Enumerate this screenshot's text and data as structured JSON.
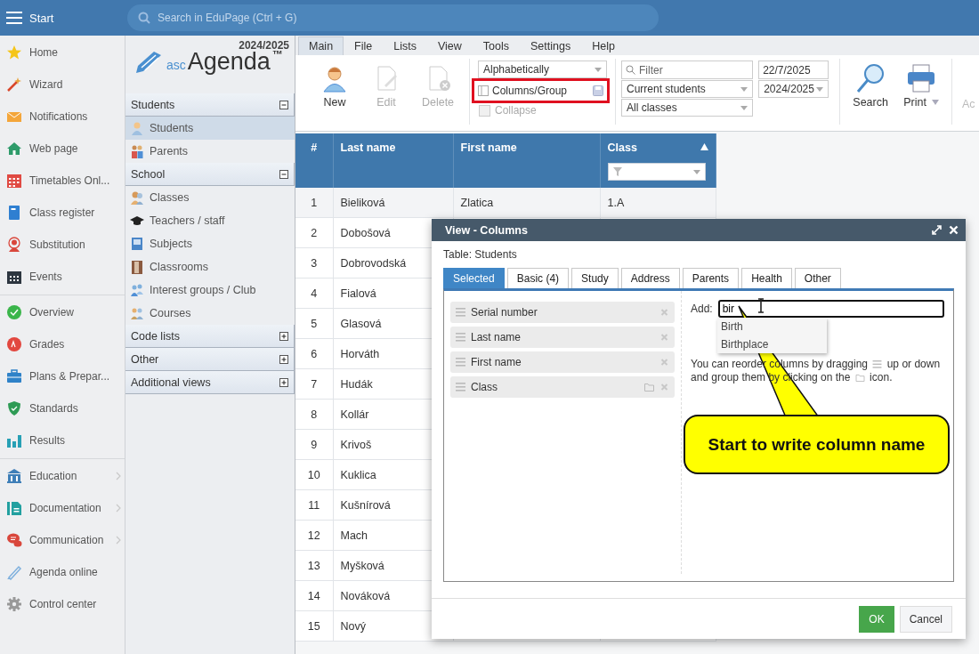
{
  "topbar": {
    "title": "Start",
    "search": {
      "placeholder": "Search in EduPage (Ctrl + G)"
    }
  },
  "sidebar": {
    "sections": [
      {
        "items": [
          {
            "label": "Home",
            "has_submenu": false
          },
          {
            "label": "Wizard",
            "has_submenu": false
          },
          {
            "label": "Notifications",
            "has_submenu": false
          },
          {
            "label": "Web page",
            "has_submenu": false
          },
          {
            "label": "Timetables Onl...",
            "has_submenu": false
          },
          {
            "label": "Class register",
            "has_submenu": false
          },
          {
            "label": "Substitution",
            "has_submenu": false
          },
          {
            "label": "Events",
            "has_submenu": false
          }
        ]
      },
      {
        "items": [
          {
            "label": "Overview",
            "has_submenu": false
          },
          {
            "label": "Grades",
            "has_submenu": false
          },
          {
            "label": "Plans & Prepar...",
            "has_submenu": false
          },
          {
            "label": "Standards",
            "has_submenu": false
          },
          {
            "label": "Results",
            "has_submenu": false
          }
        ]
      },
      {
        "items": [
          {
            "label": "Education",
            "has_submenu": true
          },
          {
            "label": "Documentation",
            "has_submenu": true
          },
          {
            "label": "Communication",
            "has_submenu": true
          },
          {
            "label": "Agenda online",
            "has_submenu": false
          },
          {
            "label": "Control center",
            "has_submenu": false
          }
        ]
      }
    ]
  },
  "navigator": {
    "year": "2024/2025",
    "logo": {
      "prefix": "asc",
      "name": "Agenda",
      "mark": "™"
    },
    "sections": [
      {
        "title": "Students",
        "expanded": true,
        "items": [
          {
            "label": "Students",
            "selected": true
          },
          {
            "label": "Parents",
            "selected": false
          }
        ]
      },
      {
        "title": "School",
        "expanded": true,
        "items": [
          {
            "label": "Classes",
            "selected": false
          },
          {
            "label": "Teachers / staff",
            "selected": false
          },
          {
            "label": "Subjects",
            "selected": false
          },
          {
            "label": "Classrooms",
            "selected": false
          },
          {
            "label": "Interest groups / Club",
            "selected": false
          },
          {
            "label": "Courses",
            "selected": false
          }
        ]
      },
      {
        "title": "Code lists",
        "expanded": false
      },
      {
        "title": "Other",
        "expanded": false
      },
      {
        "title": "Additional views",
        "expanded": false
      }
    ]
  },
  "ribbon": {
    "tabs": [
      {
        "label": "Main",
        "selected": true
      },
      {
        "label": "File",
        "selected": false
      },
      {
        "label": "Lists",
        "selected": false
      },
      {
        "label": "View",
        "selected": false
      },
      {
        "label": "Tools",
        "selected": false
      },
      {
        "label": "Settings",
        "selected": false
      },
      {
        "label": "Help",
        "selected": false
      }
    ],
    "actions": [
      {
        "label": "New",
        "disabled": false
      },
      {
        "label": "Edit",
        "disabled": true
      },
      {
        "label": "Delete",
        "disabled": true
      }
    ],
    "sort": {
      "value": "Alphabetically"
    },
    "columns_group": {
      "label": "Columns/Group",
      "highlighted": true
    },
    "collapse": {
      "label": "Collapse",
      "checked": false,
      "disabled": true
    },
    "filter": {
      "placeholder": "Filter"
    },
    "status_select": {
      "value": "Current students"
    },
    "class_select": {
      "value": "All classes"
    },
    "date": {
      "value": "22/7/2025"
    },
    "year_select": {
      "value": "2024/2025"
    },
    "tools": [
      {
        "label": "Search",
        "has_menu": false,
        "disabled": false
      },
      {
        "label": "Print",
        "has_menu": true,
        "disabled": false
      },
      {
        "label": "Ac",
        "has_menu": false,
        "disabled": true
      }
    ]
  },
  "table": {
    "columns": [
      {
        "label": "#",
        "sorted": false,
        "filter": false
      },
      {
        "label": "Last name",
        "sorted": false,
        "filter": false
      },
      {
        "label": "First name",
        "sorted": false,
        "filter": false
      },
      {
        "label": "Class",
        "sorted": true,
        "filter": true
      }
    ],
    "rows": [
      {
        "number": "1",
        "last_name": "Bieliková",
        "first_name": "Zlatica",
        "class": "1.A"
      },
      {
        "number": "2",
        "last_name": "Dobošová"
      },
      {
        "number": "3",
        "last_name": "Dobrovodská"
      },
      {
        "number": "4",
        "last_name": "Fialová"
      },
      {
        "number": "5",
        "last_name": "Glasová"
      },
      {
        "number": "6",
        "last_name": "Horváth"
      },
      {
        "number": "7",
        "last_name": "Hudák"
      },
      {
        "number": "8",
        "last_name": "Kollár"
      },
      {
        "number": "9",
        "last_name": "Krivoš"
      },
      {
        "number": "10",
        "last_name": "Kuklica"
      },
      {
        "number": "11",
        "last_name": "Kušnírová"
      },
      {
        "number": "12",
        "last_name": "Mach"
      },
      {
        "number": "13",
        "last_name": "Myšková"
      },
      {
        "number": "14",
        "last_name": "Nováková"
      },
      {
        "number": "15",
        "last_name": "Nový"
      }
    ]
  },
  "dialog": {
    "title": "View - Columns",
    "table_label": "Table: Students",
    "tabs": [
      {
        "label": "Selected",
        "selected": true
      },
      {
        "label": "Basic (4)",
        "selected": false
      },
      {
        "label": "Study",
        "selected": false
      },
      {
        "label": "Address",
        "selected": false
      },
      {
        "label": "Parents",
        "selected": false
      },
      {
        "label": "Health",
        "selected": false
      },
      {
        "label": "Other",
        "selected": false
      }
    ],
    "columns": [
      {
        "label": "Serial number",
        "groupable": false
      },
      {
        "label": "Last name",
        "groupable": false
      },
      {
        "label": "First name",
        "groupable": false
      },
      {
        "label": "Class",
        "groupable": true
      }
    ],
    "add": {
      "label": "Add:",
      "value": "bir",
      "suggestions": [
        "Birth",
        "Birthplace"
      ]
    },
    "help": [
      "You can reorder columns by dragging",
      "up or down and group them by clicking on the",
      "icon."
    ],
    "buttons": [
      {
        "label": "OK",
        "kind": "primary"
      },
      {
        "label": "Cancel",
        "kind": "secondary"
      }
    ]
  },
  "callout": {
    "text": "Start to write column name"
  }
}
